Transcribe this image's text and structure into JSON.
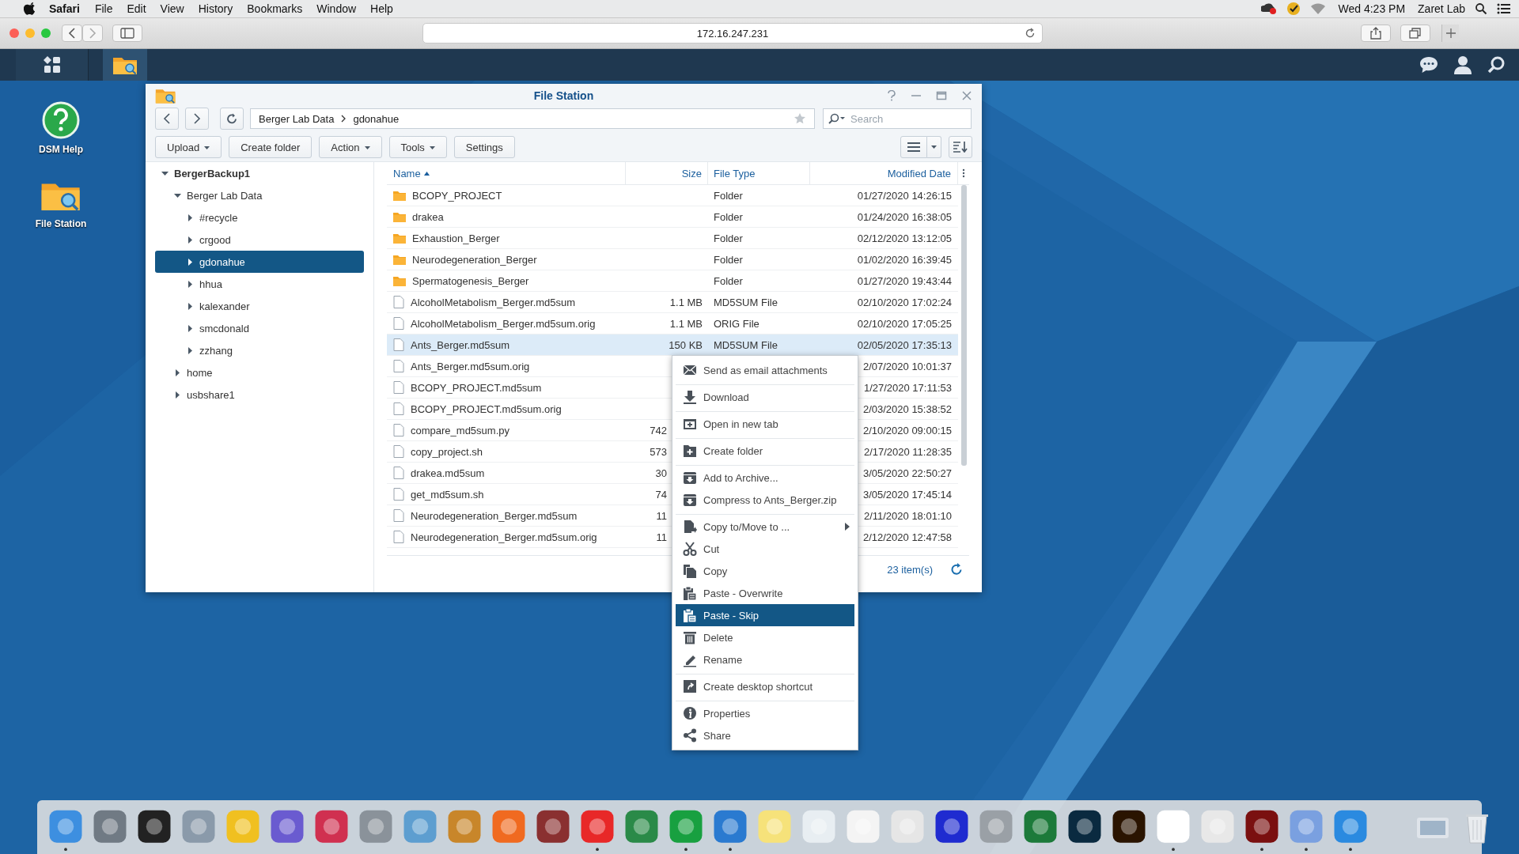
{
  "menu_bar": {
    "app": "Safari",
    "menus": [
      "File",
      "Edit",
      "View",
      "History",
      "Bookmarks",
      "Window",
      "Help"
    ],
    "clock": "Wed 4:23 PM",
    "user": "Zaret Lab"
  },
  "browser": {
    "address": "172.16.247.231"
  },
  "desktop_icons": [
    {
      "label": "DSM Help",
      "kind": "help"
    },
    {
      "label": "File Station",
      "kind": "filestation"
    }
  ],
  "window": {
    "title": "File Station",
    "breadcrumb": [
      "Berger Lab Data",
      "gdonahue"
    ],
    "search": {
      "placeholder": "Search"
    },
    "toolbar": [
      {
        "label": "Upload",
        "dropdown": true
      },
      {
        "label": "Create folder",
        "dropdown": false
      },
      {
        "label": "Action",
        "dropdown": true
      },
      {
        "label": "Tools",
        "dropdown": true
      },
      {
        "label": "Settings",
        "dropdown": false
      }
    ]
  },
  "tree": [
    {
      "label": "BergerBackup1",
      "expanded": true,
      "selected": false,
      "children": [
        {
          "label": "Berger Lab Data",
          "expanded": true,
          "selected": false,
          "children": [
            {
              "label": "#recycle",
              "expanded": false,
              "selected": false
            },
            {
              "label": "crgood",
              "expanded": false,
              "selected": false
            },
            {
              "label": "gdonahue",
              "expanded": false,
              "selected": true
            },
            {
              "label": "hhua",
              "expanded": false,
              "selected": false
            },
            {
              "label": "kalexander",
              "expanded": false,
              "selected": false
            },
            {
              "label": "smcdonald",
              "expanded": false,
              "selected": false
            },
            {
              "label": "zzhang",
              "expanded": false,
              "selected": false
            }
          ]
        },
        {
          "label": "home",
          "expanded": false,
          "selected": false
        },
        {
          "label": "usbshare1",
          "expanded": false,
          "selected": false
        }
      ]
    }
  ],
  "table": {
    "columns": [
      {
        "label": "Name",
        "sorted": true
      },
      {
        "label": "Size",
        "sorted": false
      },
      {
        "label": "File Type",
        "sorted": false
      },
      {
        "label": "Modified Date",
        "sorted": false
      }
    ],
    "rows": [
      {
        "kind": "folder",
        "name": "BCOPY_PROJECT",
        "type": "Folder",
        "modified": "01/27/2020 14:26:15",
        "selected": false
      },
      {
        "kind": "folder",
        "name": "drakea",
        "type": "Folder",
        "modified": "01/24/2020 16:38:05",
        "selected": false
      },
      {
        "kind": "folder",
        "name": "Exhaustion_Berger",
        "type": "Folder",
        "modified": "02/12/2020 13:12:05",
        "selected": false
      },
      {
        "kind": "folder",
        "name": "Neurodegeneration_Berger",
        "type": "Folder",
        "modified": "01/02/2020 16:39:45",
        "selected": false
      },
      {
        "kind": "folder",
        "name": "Spermatogenesis_Berger",
        "type": "Folder",
        "modified": "01/27/2020 19:43:44",
        "selected": false
      },
      {
        "kind": "file",
        "name": "AlcoholMetabolism_Berger.md5sum",
        "size": "1.1 MB",
        "type": "MD5SUM File",
        "modified": "02/10/2020 17:02:24",
        "selected": false
      },
      {
        "kind": "file",
        "name": "AlcoholMetabolism_Berger.md5sum.orig",
        "size": "1.1 MB",
        "type": "ORIG File",
        "modified": "02/10/2020 17:05:25",
        "selected": false
      },
      {
        "kind": "file",
        "name": "Ants_Berger.md5sum",
        "size": "150 KB",
        "type": "MD5SUM File",
        "modified": "02/05/2020 17:35:13",
        "selected": true
      },
      {
        "kind": "file",
        "name": "Ants_Berger.md5sum.orig",
        "modified": "2/07/2020 10:01:37",
        "selected": false
      },
      {
        "kind": "file",
        "name": "BCOPY_PROJECT.md5sum",
        "modified": "1/27/2020 17:11:53",
        "selected": false
      },
      {
        "kind": "file",
        "name": "BCOPY_PROJECT.md5sum.orig",
        "modified": "2/03/2020 15:38:52",
        "selected": false
      },
      {
        "kind": "file",
        "name": "compare_md5sum.py",
        "size": "742",
        "modified": "2/10/2020 09:00:15",
        "selected": false
      },
      {
        "kind": "file",
        "name": "copy_project.sh",
        "size": "573",
        "modified": "2/17/2020 11:28:35",
        "selected": false
      },
      {
        "kind": "file",
        "name": "drakea.md5sum",
        "size": "30",
        "modified": "3/05/2020 22:50:27",
        "selected": false
      },
      {
        "kind": "file",
        "name": "get_md5sum.sh",
        "size": "74",
        "modified": "3/05/2020 17:45:14",
        "selected": false
      },
      {
        "kind": "file",
        "name": "Neurodegeneration_Berger.md5sum",
        "size": "11",
        "modified": "2/11/2020 18:01:10",
        "selected": false
      },
      {
        "kind": "file",
        "name": "Neurodegeneration_Berger.md5sum.orig",
        "size": "11",
        "modified": "2/12/2020 12:47:58",
        "selected": false
      }
    ]
  },
  "status_bar": {
    "count": "23 item(s)"
  },
  "context_menu": {
    "items": [
      {
        "kind": "email",
        "label": "Send as email attachments",
        "highlighted": false,
        "submenu": false,
        "separator_after": true
      },
      {
        "kind": "download",
        "label": "Download",
        "highlighted": false,
        "submenu": false,
        "separator_after": true
      },
      {
        "kind": "newtab",
        "label": "Open in new tab",
        "highlighted": false,
        "submenu": false,
        "separator_after": true
      },
      {
        "kind": "newfolder",
        "label": "Create folder",
        "highlighted": false,
        "submenu": false,
        "separator_after": true
      },
      {
        "kind": "archive",
        "label": "Add to Archive...",
        "highlighted": false,
        "submenu": false,
        "separator_after": false
      },
      {
        "kind": "archive",
        "label": "Compress to Ants_Berger.zip",
        "highlighted": false,
        "submenu": false,
        "separator_after": true
      },
      {
        "kind": "copymove",
        "label": "Copy to/Move to ...",
        "highlighted": false,
        "submenu": true,
        "separator_after": false
      },
      {
        "kind": "cut",
        "label": "Cut",
        "highlighted": false,
        "submenu": false,
        "separator_after": false
      },
      {
        "kind": "copy",
        "label": "Copy",
        "highlighted": false,
        "submenu": false,
        "separator_after": false
      },
      {
        "kind": "paste",
        "label": "Paste - Overwrite",
        "highlighted": false,
        "submenu": false,
        "separator_after": false
      },
      {
        "kind": "paste",
        "label": "Paste - Skip",
        "highlighted": true,
        "submenu": false,
        "separator_after": false
      },
      {
        "kind": "delete",
        "label": "Delete",
        "highlighted": false,
        "submenu": false,
        "separator_after": false
      },
      {
        "kind": "rename",
        "label": "Rename",
        "highlighted": false,
        "submenu": false,
        "separator_after": true
      },
      {
        "kind": "shortcut",
        "label": "Create desktop shortcut",
        "highlighted": false,
        "submenu": false,
        "separator_after": true
      },
      {
        "kind": "info",
        "label": "Properties",
        "highlighted": false,
        "submenu": false,
        "separator_after": false
      },
      {
        "kind": "share",
        "label": "Share",
        "highlighted": false,
        "submenu": false,
        "separator_after": false
      }
    ]
  },
  "dock": {
    "apps": [
      {
        "running": true
      },
      {
        "running": false
      },
      {
        "running": false
      },
      {
        "running": false
      },
      {
        "running": false
      },
      {
        "running": false
      },
      {
        "running": false
      },
      {
        "running": false
      },
      {
        "running": false
      },
      {
        "running": false
      },
      {
        "running": false
      },
      {
        "running": false
      },
      {
        "running": true
      },
      {
        "running": false
      },
      {
        "running": true
      },
      {
        "running": true
      },
      {
        "running": false
      },
      {
        "running": false
      },
      {
        "running": false
      },
      {
        "running": false
      },
      {
        "running": false
      },
      {
        "running": false
      },
      {
        "running": false
      },
      {
        "running": false
      },
      {
        "running": false
      },
      {
        "running": true
      },
      {
        "running": false
      },
      {
        "running": true
      },
      {
        "running": true
      },
      {
        "running": true
      }
    ]
  }
}
